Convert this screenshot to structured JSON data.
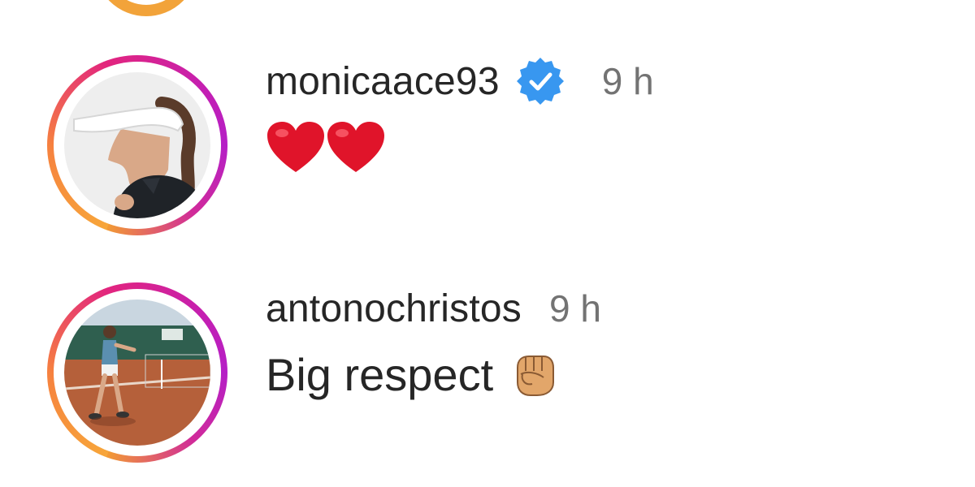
{
  "comments": [
    {
      "username": "monicaace93",
      "verified": true,
      "timestamp": "9 h",
      "text": "",
      "emojis": [
        "red-heart",
        "red-heart"
      ],
      "avatar": "woman-white-visor-profile"
    },
    {
      "username": "antonochristos",
      "verified": false,
      "timestamp": "9 h",
      "text": "Big respect",
      "emojis": [
        "raised-fist"
      ],
      "avatar": "tennis-player-clay-court"
    }
  ],
  "colors": {
    "verified_blue": "#3897f0",
    "ring_orange": "#f7a63a",
    "ring_magenta": "#c41fb2",
    "timestamp_gray": "#737373",
    "text_dark": "#262626"
  }
}
